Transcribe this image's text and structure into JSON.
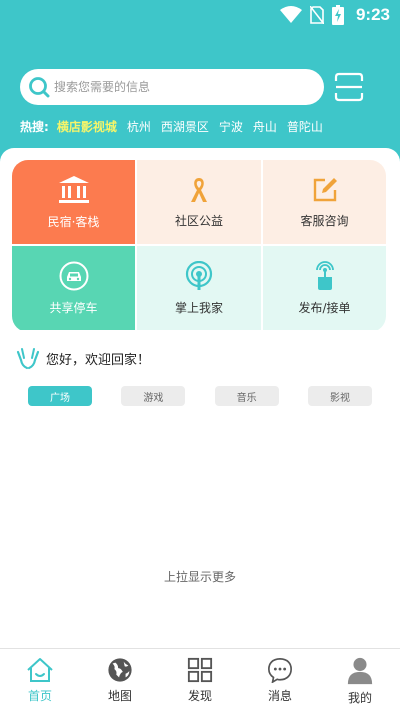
{
  "status": {
    "time": "9:23"
  },
  "search": {
    "placeholder": "搜索您需要的信息"
  },
  "hot": {
    "label": "热搜:",
    "items": [
      "横店影视城",
      "杭州",
      "西湖景区",
      "宁波",
      "舟山",
      "普陀山"
    ]
  },
  "grid": {
    "items": [
      {
        "label": "民宿·客栈",
        "icon": "building-icon"
      },
      {
        "label": "社区公益",
        "icon": "ribbon-icon"
      },
      {
        "label": "客服咨询",
        "icon": "edit-icon"
      },
      {
        "label": "共享停车",
        "icon": "car-icon"
      },
      {
        "label": "掌上我家",
        "icon": "signal-icon"
      },
      {
        "label": "发布/接单",
        "icon": "hand-signal-icon"
      }
    ]
  },
  "welcome": {
    "text": "您好，欢迎回家！"
  },
  "tabs": [
    "广场",
    "游戏",
    "音乐",
    "影视"
  ],
  "more": {
    "text": "上拉显示更多"
  },
  "nav": {
    "items": [
      {
        "label": "首页",
        "icon": "home-icon"
      },
      {
        "label": "地图",
        "icon": "globe-icon"
      },
      {
        "label": "发现",
        "icon": "grid-icon"
      },
      {
        "label": "消息",
        "icon": "chat-icon"
      },
      {
        "label": "我的",
        "icon": "user-icon"
      }
    ]
  },
  "colors": {
    "primary": "#3ec6c9",
    "orange": "#fc7b4f",
    "peach": "#fdeee4",
    "green": "#58d6b3",
    "mint": "#e3f8f3",
    "highlight": "#f5f56a"
  }
}
